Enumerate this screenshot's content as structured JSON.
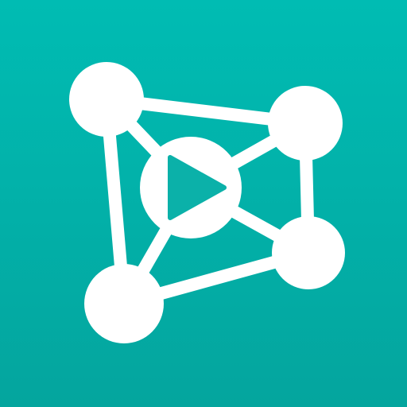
{
  "icon": {
    "kind": "app-icon",
    "symbol": "network-graph-play-icon",
    "colors": {
      "background_top": "#00bcb3",
      "background_bottom": "#04a59e",
      "foreground": "#ffffff"
    }
  }
}
